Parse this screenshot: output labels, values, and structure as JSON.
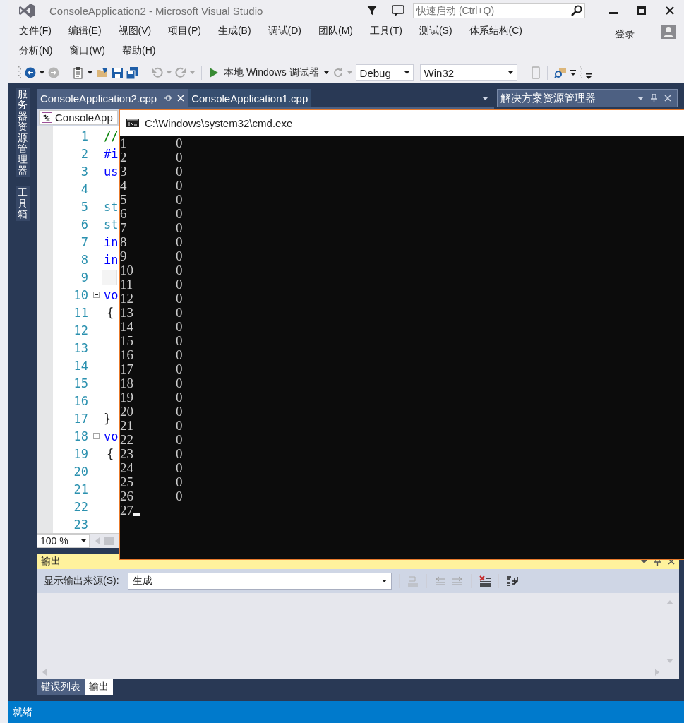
{
  "window": {
    "title": "ConsoleApplication2 - Microsoft Visual Studio"
  },
  "quick_launch": {
    "placeholder": "快速启动 (Ctrl+Q)"
  },
  "menu": {
    "rows": [
      [
        "文件(F)",
        "编辑(E)",
        "视图(V)",
        "项目(P)",
        "生成(B)",
        "调试(D)",
        "团队(M)",
        "工具(T)",
        "测试(S)",
        "体系结构(C)"
      ],
      [
        "分析(N)",
        "窗口(W)",
        "帮助(H)"
      ]
    ],
    "sign_in": "登录"
  },
  "toolbar": {
    "debugger": "本地 Windows 调试器",
    "configuration": "Debug",
    "platform": "Win32"
  },
  "side_tabs": [
    "服务器资源管理器",
    "工具箱"
  ],
  "document_tabs": [
    {
      "label": "ConsoleApplication2.cpp",
      "selected": true
    },
    {
      "label": "ConsoleApplication1.cpp",
      "selected": false
    }
  ],
  "solution_explorer": {
    "title": "解决方案资源管理器"
  },
  "editor": {
    "navigation": "ConsoleApp",
    "zoom": "100 %",
    "lines": [
      {
        "number": "1",
        "code": "//",
        "kind": "comment",
        "fold": false
      },
      {
        "number": "2",
        "code": "#i",
        "kind": "preprocessor",
        "fold": false
      },
      {
        "number": "3",
        "code": "us",
        "kind": "keyword",
        "fold": false
      },
      {
        "number": "4",
        "kind": "plain",
        "fold": false
      },
      {
        "number": "5",
        "code": "st",
        "kind": "type",
        "fold": false
      },
      {
        "number": "6",
        "code": "st",
        "kind": "type",
        "fold": false
      },
      {
        "number": "7",
        "code": "in",
        "kind": "keyword",
        "fold": false
      },
      {
        "number": "8",
        "code": "in",
        "kind": "keyword",
        "fold": false
      },
      {
        "number": "9",
        "kind": "box",
        "fold": false
      },
      {
        "number": "10",
        "code": "vo",
        "kind": "keyword",
        "fold": true
      },
      {
        "number": "11",
        "code": "{",
        "kind": "brace",
        "fold": false
      },
      {
        "number": "12",
        "kind": "plain",
        "fold": false
      },
      {
        "number": "13",
        "kind": "plain",
        "fold": false
      },
      {
        "number": "14",
        "kind": "plain",
        "fold": false
      },
      {
        "number": "15",
        "kind": "plain",
        "fold": false
      },
      {
        "number": "16",
        "kind": "plain",
        "fold": false
      },
      {
        "number": "17",
        "code": "}",
        "kind": "brace-end",
        "fold": false
      },
      {
        "number": "18",
        "code": "vo",
        "kind": "keyword",
        "fold": true
      },
      {
        "number": "19",
        "code": "{",
        "kind": "brace",
        "fold": false
      },
      {
        "number": "20",
        "kind": "plain",
        "fold": false
      },
      {
        "number": "21",
        "kind": "plain",
        "fold": false
      },
      {
        "number": "22",
        "kind": "plain",
        "fold": false
      },
      {
        "number": "23",
        "kind": "plain",
        "fold": false
      }
    ]
  },
  "console": {
    "title": "C:\\Windows\\system32\\cmd.exe",
    "cursor": true,
    "lines": [
      {
        "column_1": "1",
        "column_2": "0"
      },
      {
        "column_1": "2",
        "column_2": "0"
      },
      {
        "column_1": "3",
        "column_2": "0"
      },
      {
        "column_1": "4",
        "column_2": "0"
      },
      {
        "column_1": "5",
        "column_2": "0"
      },
      {
        "column_1": "6",
        "column_2": "0"
      },
      {
        "column_1": "7",
        "column_2": "0"
      },
      {
        "column_1": "8",
        "column_2": "0"
      },
      {
        "column_1": "9",
        "column_2": "0"
      },
      {
        "column_1": "10",
        "column_2": "0"
      },
      {
        "column_1": "11",
        "column_2": "0"
      },
      {
        "column_1": "12",
        "column_2": "0"
      },
      {
        "column_1": "13",
        "column_2": "0"
      },
      {
        "column_1": "14",
        "column_2": "0"
      },
      {
        "column_1": "15",
        "column_2": "0"
      },
      {
        "column_1": "16",
        "column_2": "0"
      },
      {
        "column_1": "17",
        "column_2": "0"
      },
      {
        "column_1": "18",
        "column_2": "0"
      },
      {
        "column_1": "19",
        "column_2": "0"
      },
      {
        "column_1": "20",
        "column_2": "0"
      },
      {
        "column_1": "21",
        "column_2": "0"
      },
      {
        "column_1": "22",
        "column_2": "0"
      },
      {
        "column_1": "23",
        "column_2": "0"
      },
      {
        "column_1": "24",
        "column_2": "0"
      },
      {
        "column_1": "25",
        "column_2": "0"
      },
      {
        "column_1": "26",
        "column_2": "0"
      },
      {
        "column_1": "27"
      }
    ]
  },
  "output": {
    "title": "输出",
    "source_label": "显示输出来源(S):",
    "source": "生成"
  },
  "bottom_tabs": [
    {
      "label": "错误列表",
      "selected": false
    },
    {
      "label": "输出",
      "selected": true
    }
  ],
  "status_bar": {
    "text": "就绪"
  }
}
